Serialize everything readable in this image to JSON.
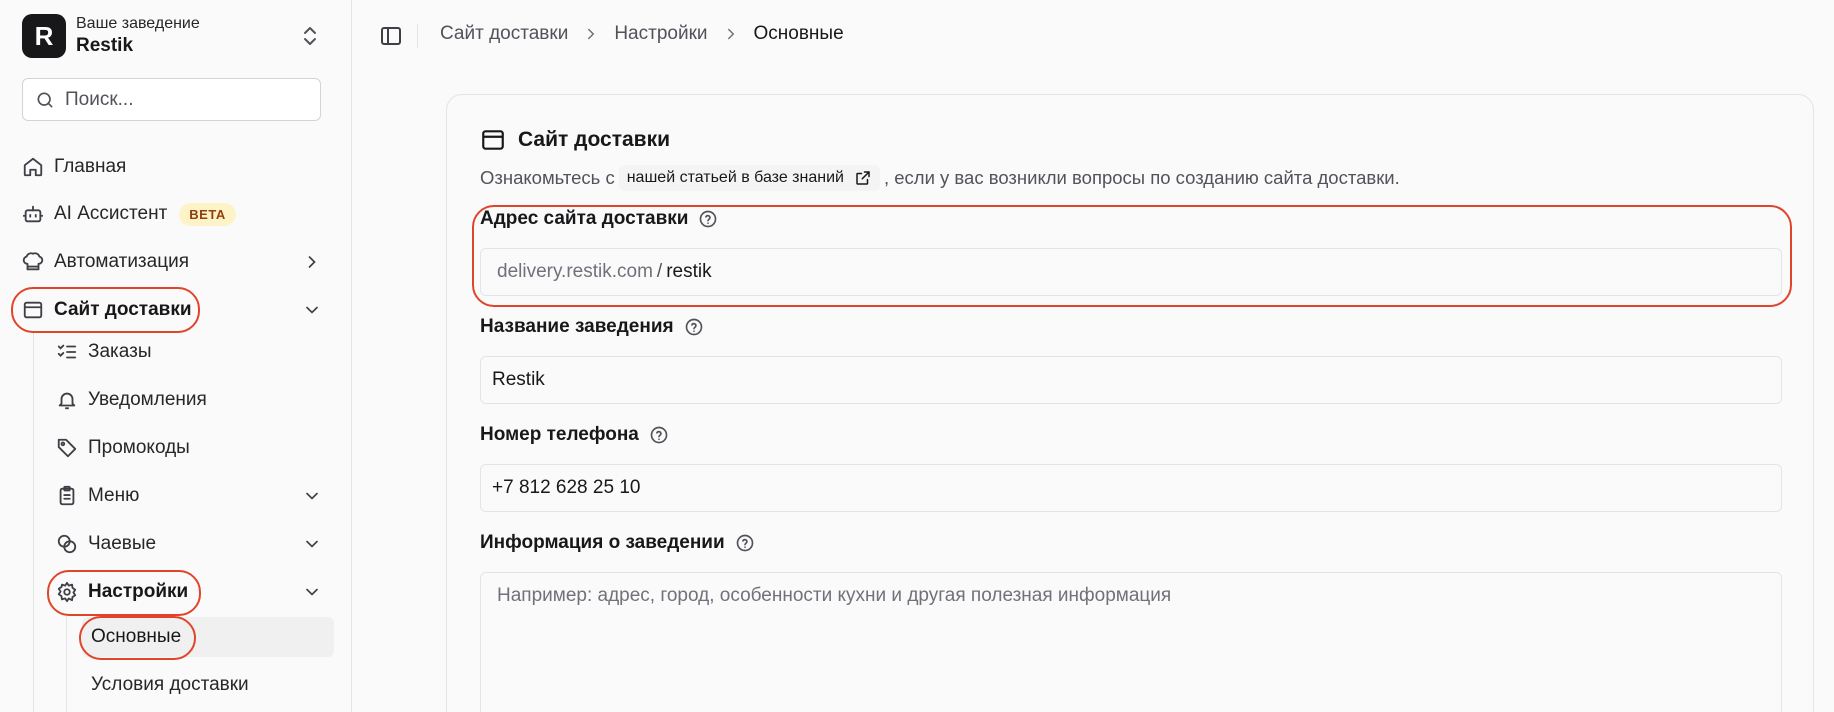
{
  "brand": {
    "logo_letter": "R",
    "subtitle": "Ваше заведение",
    "name": "Restik"
  },
  "search": {
    "placeholder": "Поиск..."
  },
  "nav": {
    "home": "Главная",
    "ai": "AI Ассистент",
    "ai_badge": "BETA",
    "automation": "Автоматизация",
    "delivery_site": "Сайт доставки",
    "orders": "Заказы",
    "notifications": "Уведомления",
    "promocodes": "Промокоды",
    "menu": "Меню",
    "tips": "Чаевые",
    "settings": "Настройки",
    "settings_main": "Основные",
    "delivery_conditions": "Условия доставки"
  },
  "breadcrumb": [
    "Сайт доставки",
    "Настройки",
    "Основные"
  ],
  "card": {
    "title": "Сайт доставки",
    "desc_before": "Ознакомьтесь с",
    "desc_link": "нашей статьей в базе знаний",
    "desc_after": ", если у вас возникли вопросы по созданию сайта доставки."
  },
  "fields": {
    "address_label": "Адрес сайта доставки",
    "address_prefix": "delivery.restik.com",
    "address_sep": "/",
    "address_value": "restik",
    "name_label": "Название заведения",
    "name_value": "Restik",
    "phone_label": "Номер телефона",
    "phone_value": "+7 812 628 25 10",
    "info_label": "Информация о заведении",
    "info_placeholder": "Например: адрес, город, особенности кухни и другая полезная информация"
  },
  "colors": {
    "highlight": "#e0452c",
    "badge_bg": "#fef3c7",
    "badge_text": "#92400e"
  },
  "icons": [
    "home-icon",
    "bot-icon",
    "chef-hat-icon",
    "browser-icon",
    "list-checks-icon",
    "bell-icon",
    "tag-icon",
    "clipboard-icon",
    "coins-icon",
    "gear-icon",
    "chevron-right-icon",
    "chevron-down-icon",
    "search-icon",
    "sidebar-toggle-icon",
    "help-circle-icon",
    "external-link-icon"
  ]
}
